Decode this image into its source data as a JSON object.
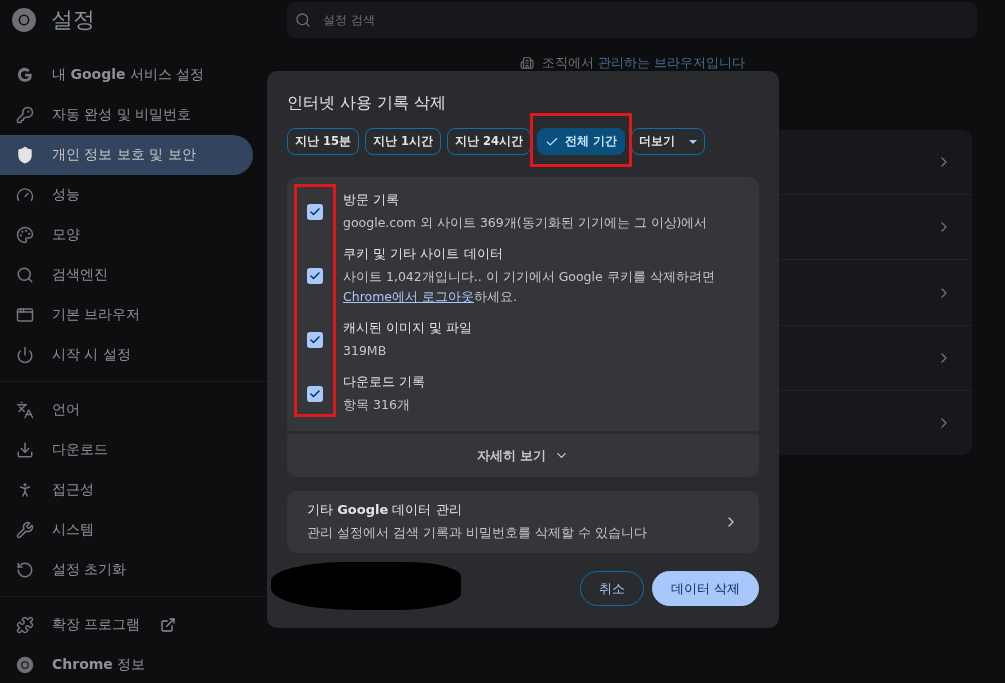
{
  "header": {
    "title": "설정",
    "search": {
      "placeholder": "설정 검색"
    }
  },
  "sidebar": {
    "sections": [
      [
        {
          "label": "내 **Google** 서비스 설정",
          "selected": false
        },
        {
          "label": "자동 완성 및 비밀번호",
          "selected": false
        },
        {
          "label": "개인 정보 보호 및 보안",
          "selected": true
        },
        {
          "label": "성능",
          "selected": false
        },
        {
          "label": "모양",
          "selected": false
        },
        {
          "label": "검색엔진",
          "selected": false
        },
        {
          "label": "기본 브라우저",
          "selected": false
        },
        {
          "label": "시작 시 설정",
          "selected": false
        }
      ],
      [
        {
          "label": "언어",
          "selected": false
        },
        {
          "label": "다운로드",
          "selected": false
        },
        {
          "label": "접근성",
          "selected": false
        },
        {
          "label": "시스템",
          "selected": false
        },
        {
          "label": "설정 초기화",
          "selected": false
        }
      ],
      [
        {
          "label": "확장 프로그램",
          "selected": false,
          "external": true
        },
        {
          "label": "**Chrome** 정보",
          "selected": false
        }
      ]
    ]
  },
  "notice": {
    "text": "조직에서 ",
    "link": "관리하는 브라우저입니다"
  },
  "dialog": {
    "title": "인터넷 사용 기록 삭제",
    "time_ranges": [
      {
        "label": "지난 15분",
        "selected": false
      },
      {
        "label": "지난 1시간",
        "selected": false
      },
      {
        "label": "지난 24시간",
        "selected": false
      },
      {
        "label": "전체 기간",
        "selected": true
      }
    ],
    "more": {
      "label": "더보기"
    },
    "items": [
      {
        "title": "방문 기록",
        "description": "google.com 외 사이트 369개(동기화된 기기에는 그 이상)에서",
        "checked": true
      },
      {
        "title": "쿠키 및 기타 사이트 데이터",
        "description": "사이트 1,042개입니다.. 이 기기에서 Google 쿠키를 삭제하려면",
        "link": "Chrome에서 로그아웃",
        "link_suffix": "하세요.",
        "checked": true
      },
      {
        "title": "캐시된 이미지 및 파일",
        "description": "319MB",
        "checked": true
      },
      {
        "title": "다운로드 기록",
        "description": "항목 316개",
        "checked": true
      }
    ],
    "details_toggle": "자세히 보기",
    "google_data": {
      "title": "기타 **Google** 데이터 관리",
      "description": "관리 설정에서 검색 기록과 비밀번호를 삭제할 수 있습니다"
    },
    "buttons": {
      "cancel": "취소",
      "confirm": "데이터 삭제"
    }
  }
}
